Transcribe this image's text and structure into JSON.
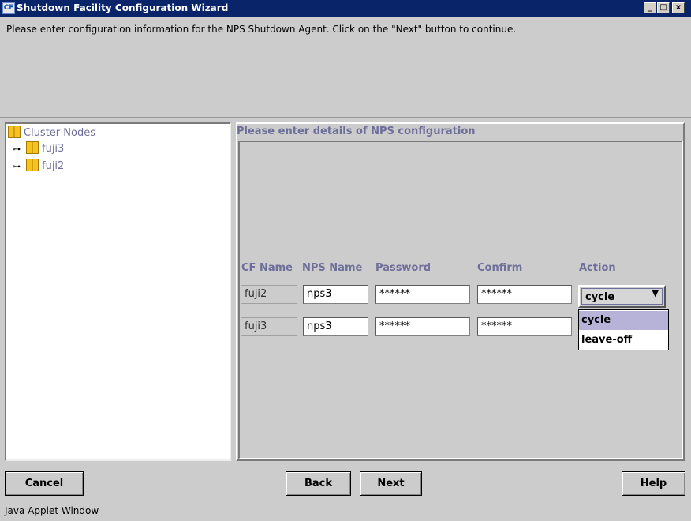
{
  "window": {
    "title": "Shutdown Facility Configuration Wizard",
    "app_icon": "cf-icon",
    "controls": {
      "minimize": "_",
      "maximize": "□",
      "close": "x"
    }
  },
  "instruction": "Please enter configuration information for the NPS Shutdown Agent. Click on the \"Next\" button to continue.",
  "tree": {
    "root": "Cluster Nodes",
    "nodes": [
      "fuji3",
      "fuji2"
    ]
  },
  "panel": {
    "title": "Please enter details of NPS configuration",
    "headers": {
      "cf_name": "CF Name",
      "nps_name": "NPS Name",
      "password": "Password",
      "confirm": "Confirm",
      "action": "Action"
    },
    "rows": [
      {
        "cf_name": "fuji2",
        "nps_name": "nps3",
        "password": "******",
        "confirm": "******",
        "action": "cycle"
      },
      {
        "cf_name": "fuji3",
        "nps_name": "nps3",
        "password": "******",
        "confirm": "******",
        "action": ""
      }
    ],
    "action_options": [
      "cycle",
      "leave-off"
    ],
    "selected_option": "cycle"
  },
  "buttons": {
    "cancel": "Cancel",
    "back": "Back",
    "next": "Next",
    "help": "Help"
  },
  "status": "Java Applet Window",
  "colors": {
    "titlebar": "#0a246a",
    "label": "#6e6e9a",
    "background": "#cccccc",
    "highlight": "#b6b2d8"
  }
}
